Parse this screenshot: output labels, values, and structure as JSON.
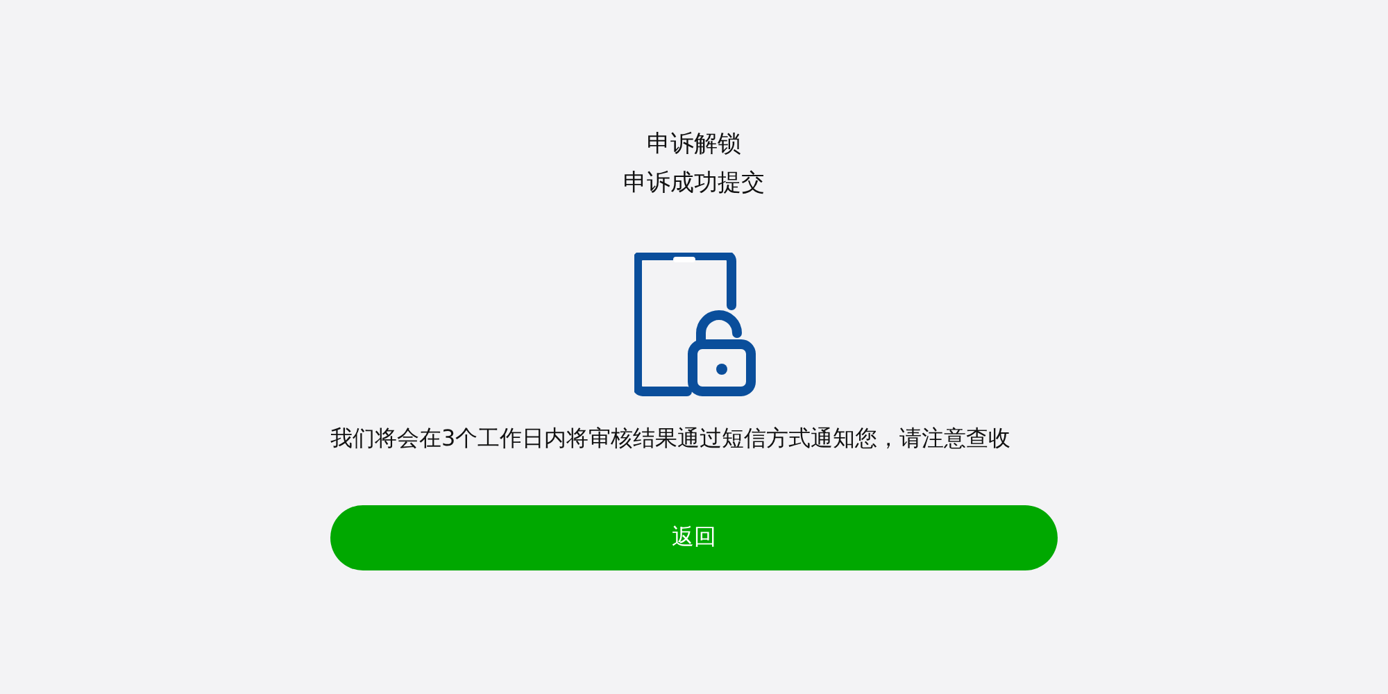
{
  "header": {
    "title": "申诉解锁",
    "subtitle": "申诉成功提交"
  },
  "message": "我们将会在3个工作日内将审核结果通过短信方式通知您，请注意查收",
  "buttons": [
    {
      "label": "返回",
      "kind": "primary"
    }
  ]
}
